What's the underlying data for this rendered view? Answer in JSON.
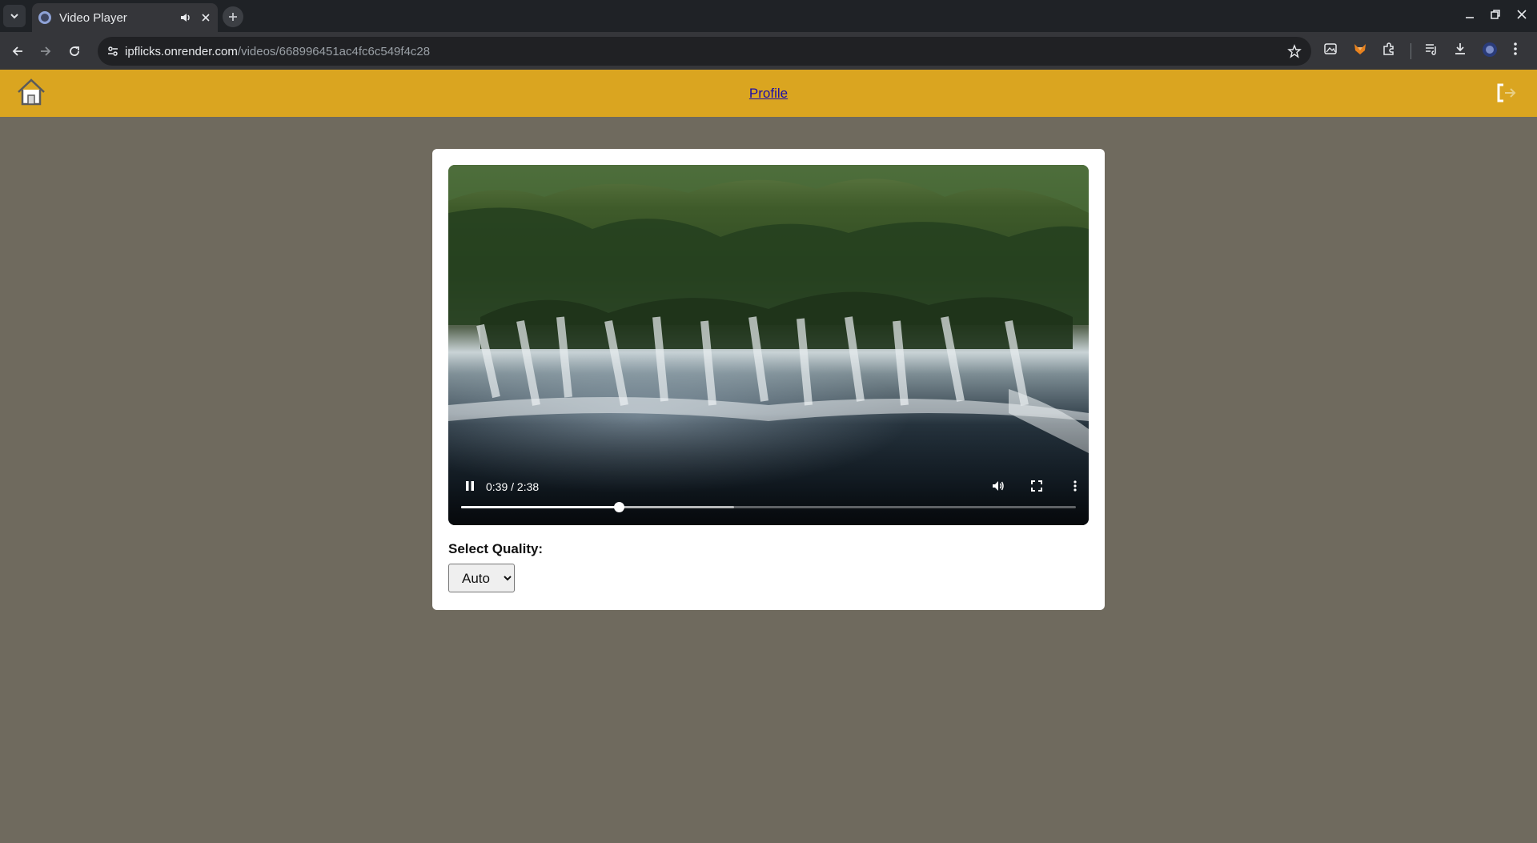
{
  "browser": {
    "tab_title": "Video Player",
    "url_host": "ipflicks.onrender.com",
    "url_path": "/videos/668996451ac4fc6c549f4c28"
  },
  "header": {
    "profile_label": "Profile"
  },
  "video": {
    "current_time": "0:39",
    "duration": "2:38",
    "time_display": "0:39 / 2:38",
    "played_fraction": 0.256,
    "buffered_fraction": 0.444
  },
  "quality": {
    "label": "Select Quality:",
    "selected": "Auto"
  },
  "colors": {
    "header_bg": "#daa520",
    "page_bg": "#6f6a5e",
    "link": "#1a0dab"
  }
}
